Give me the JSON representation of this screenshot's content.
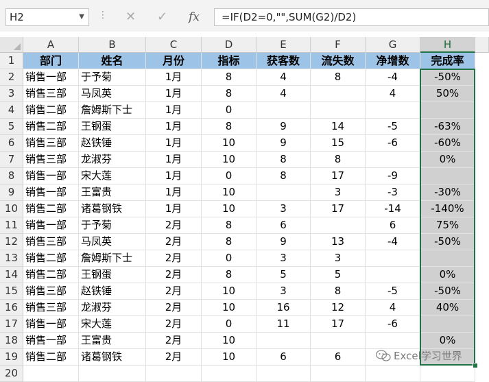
{
  "name_box": {
    "value": "H2"
  },
  "formula_bar": {
    "cancel_glyph": "✕",
    "enter_glyph": "✓",
    "fx_label": "fx",
    "formula": "=IF(D2=0,\"\",SUM(G2)/D2)"
  },
  "columns": [
    "A",
    "B",
    "C",
    "D",
    "E",
    "F",
    "G",
    "H"
  ],
  "selected_column": "H",
  "header_row": [
    "部门",
    "姓名",
    "月份",
    "指标",
    "获客数",
    "流失数",
    "净增数",
    "完成率"
  ],
  "rows": [
    [
      "销售一部",
      "于予菊",
      "1月",
      "8",
      "4",
      "8",
      "-4",
      "-50%"
    ],
    [
      "销售三部",
      "马凤英",
      "1月",
      "8",
      "4",
      "",
      "4",
      "50%"
    ],
    [
      "销售二部",
      "詹姆斯下士",
      "1月",
      "0",
      "",
      "",
      "",
      ""
    ],
    [
      "销售二部",
      "王钢蛋",
      "1月",
      "8",
      "9",
      "14",
      "-5",
      "-63%"
    ],
    [
      "销售三部",
      "赵铁锤",
      "1月",
      "10",
      "9",
      "15",
      "-6",
      "-60%"
    ],
    [
      "销售三部",
      "龙淑芬",
      "1月",
      "10",
      "8",
      "8",
      "",
      "0%"
    ],
    [
      "销售一部",
      "宋大莲",
      "1月",
      "0",
      "8",
      "17",
      "-9",
      ""
    ],
    [
      "销售一部",
      "王富贵",
      "1月",
      "10",
      "",
      "3",
      "-3",
      "-30%"
    ],
    [
      "销售二部",
      "诸葛钢铁",
      "1月",
      "10",
      "3",
      "17",
      "-14",
      "-140%"
    ],
    [
      "销售一部",
      "于予菊",
      "2月",
      "8",
      "6",
      "",
      "6",
      "75%"
    ],
    [
      "销售三部",
      "马凤英",
      "2月",
      "8",
      "9",
      "13",
      "-4",
      "-50%"
    ],
    [
      "销售二部",
      "詹姆斯下士",
      "2月",
      "0",
      "3",
      "3",
      "",
      ""
    ],
    [
      "销售二部",
      "王钢蛋",
      "2月",
      "8",
      "5",
      "5",
      "",
      "0%"
    ],
    [
      "销售三部",
      "赵铁锤",
      "2月",
      "10",
      "3",
      "8",
      "-5",
      "-50%"
    ],
    [
      "销售三部",
      "龙淑芬",
      "2月",
      "10",
      "16",
      "12",
      "4",
      "40%"
    ],
    [
      "销售一部",
      "宋大莲",
      "2月",
      "0",
      "11",
      "17",
      "-6",
      ""
    ],
    [
      "销售一部",
      "王富贵",
      "2月",
      "10",
      "",
      "",
      "",
      "0%"
    ],
    [
      "销售二部",
      "诸葛钢铁",
      "2月",
      "10",
      "6",
      "6",
      "",
      ""
    ]
  ],
  "watermark": "Excel学习世界",
  "colors": {
    "header_fill": "#9dc3e6",
    "selection": "#217346",
    "selected_fill": "#d0d0d0"
  }
}
